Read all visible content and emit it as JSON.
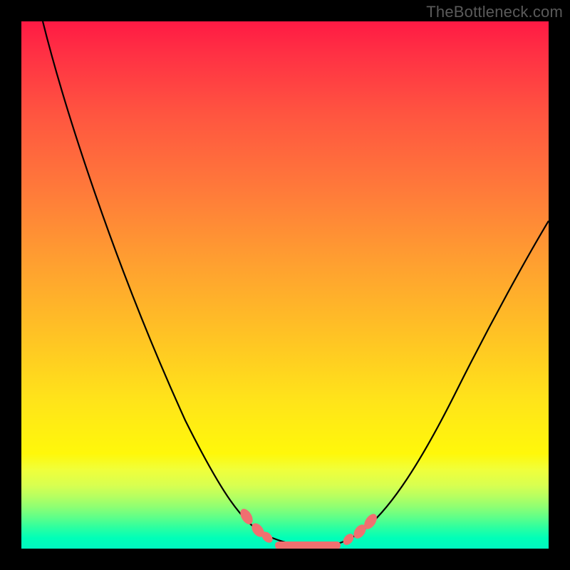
{
  "attribution": "TheBottleneck.com",
  "chart_data": {
    "type": "line",
    "title": "",
    "xlabel": "",
    "ylabel": "",
    "xlim": [
      0,
      100
    ],
    "ylim": [
      0,
      100
    ],
    "grid": false,
    "series": [
      {
        "name": "curve",
        "x": [
          4,
          8,
          12,
          16,
          20,
          24,
          28,
          32,
          36,
          40,
          44,
          47,
          50,
          54,
          58,
          62,
          66,
          70,
          76,
          82,
          88,
          94,
          100
        ],
        "y": [
          100,
          88,
          76,
          65,
          55,
          46,
          37,
          29,
          22,
          16,
          10,
          6,
          3,
          1,
          1,
          3,
          8,
          14,
          24,
          34,
          44,
          53,
          62
        ]
      }
    ],
    "markers": {
      "left_cluster_x": [
        44,
        46,
        47
      ],
      "right_cluster_x": [
        63,
        65,
        66
      ],
      "bottom_bar_x_range": [
        48,
        62
      ],
      "bottom_bar_y": 0.8
    },
    "background_gradient": {
      "top": "#ff1a44",
      "mid": "#ffe41a",
      "bottom": "#00f7c0"
    },
    "curve_color": "#000000",
    "marker_color": "#f07070"
  }
}
